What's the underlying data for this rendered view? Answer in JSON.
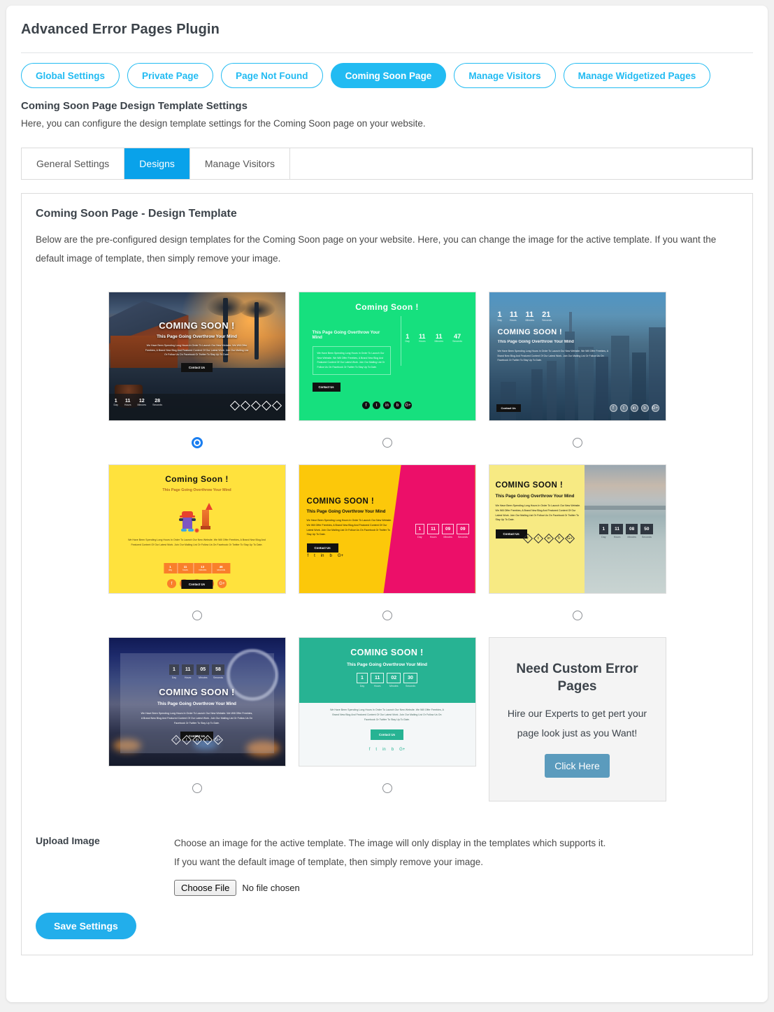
{
  "header": {
    "plugin_title": "Advanced Error Pages Plugin"
  },
  "pill_nav": {
    "items": [
      {
        "label": "Global Settings",
        "active": false
      },
      {
        "label": "Private Page",
        "active": false
      },
      {
        "label": "Page Not Found",
        "active": false
      },
      {
        "label": "Coming Soon Page",
        "active": true
      },
      {
        "label": "Manage Visitors",
        "active": false
      },
      {
        "label": "Manage Widgetized Pages",
        "active": false
      }
    ],
    "accent_color": "#22bbf2"
  },
  "section": {
    "title": "Coming Soon Page Design Template Settings",
    "description": "Here, you can configure the design template settings for the Coming Soon page on your website."
  },
  "subtabs": {
    "items": [
      {
        "label": "General Settings",
        "active": false
      },
      {
        "label": "Designs",
        "active": true
      },
      {
        "label": "Manage Visitors",
        "active": false
      }
    ],
    "active_color": "#09a2ea"
  },
  "panel": {
    "title": "Coming Soon Page - Design Template",
    "description": "Below are the pre-configured design templates for the Coming Soon page on your website. Here, you can change the image for the active template. If you want the default image of template, then simply remove your image."
  },
  "templates": [
    {
      "id": "template-1",
      "style": "tropical-resort",
      "selected": true,
      "heading": "COMING SOON !",
      "subheading": "This Page Going Overthrow Your Mind",
      "body": "We Have Been Spending Long Hours In Order To Launch Our New Website. We Will Offer Freebies, A Brand New Blog And Featured Content Of Our Latest Work. Join Our Mailing List Or Follow Us On Facebook Or Twitter To Stay Up To Date.",
      "button": "Contact Us",
      "countdown": {
        "day": "1",
        "hours": "11",
        "minutes": "12",
        "seconds": "28"
      },
      "countdown_labels": [
        "Day",
        "Hours",
        "Minutes",
        "Seconds"
      ],
      "social": [
        "f",
        "t",
        "in",
        "b",
        "G+"
      ]
    },
    {
      "id": "template-2",
      "style": "green-flat",
      "selected": false,
      "heading": "Coming Soon !",
      "subheading": "This Page Going Overthrow Your Mind",
      "body": "We Have Been Spending Long Hours In Order To Launch Our New Website. We Will Offer Freebies, A Brand New Blog And Featured Content Of Our Latest Work. Join Our Mailing List Or Follow Us On Facebook Or Twitter To Stay Up To Date.",
      "button": "Contact Us",
      "countdown": {
        "day": "1",
        "hours": "11",
        "minutes": "11",
        "seconds": "47"
      },
      "countdown_labels": [
        "Day",
        "Hours",
        "Minutes",
        "Seconds"
      ],
      "social": [
        "f",
        "t",
        "in",
        "b",
        "G+"
      ],
      "bg_color": "#16e07e"
    },
    {
      "id": "template-3",
      "style": "city-skyline-blue",
      "selected": false,
      "heading": "COMING SOON !",
      "subheading": "This Page Going Overthrow Your Mind",
      "body": "We Have Been Spending Long Hours In Order To Launch Our New Website. We Will Offer Freebies, A Brand New Blog And Featured Content Of Our Latest Work. Join Our Mailing List Or Follow Us On Facebook Or Twitter To Stay Up To Date.",
      "button": "Contact Us",
      "countdown": {
        "day": "1",
        "hours": "11",
        "minutes": "11",
        "seconds": "21"
      },
      "countdown_labels": [
        "Day",
        "Hours",
        "Minutes",
        "Seconds"
      ],
      "social": [
        "f",
        "t",
        "in",
        "b",
        "G+"
      ]
    },
    {
      "id": "template-4",
      "style": "yellow-rocket",
      "selected": false,
      "heading": "Coming Soon !",
      "subheading": "This Page Going Overthrow Your Mind",
      "body": "We Have Been Spending Long Hours In Order To Launch Our New Website. We Will Offer Freebies, A Brand New Blog And Featured Content Of Our Latest Work. Join Our Mailing List Or Follow Us On Facebook Or Twitter To Stay Up To Date.",
      "button": "Contact Us",
      "countdown": {
        "day": "1",
        "hours": "11",
        "minutes": "13",
        "seconds": "46"
      },
      "countdown_labels": [
        "day",
        "hours",
        "minutes",
        "seconds"
      ],
      "social": [
        "f",
        "t",
        "in",
        "b",
        "G+"
      ],
      "bg_color": "#ffe23d"
    },
    {
      "id": "template-5",
      "style": "yellow-pink-split",
      "selected": false,
      "heading": "COMING SOON !",
      "subheading": "This Page Going Overthrow Your Mind",
      "body": "We Have Been Spending Long Hours In Order To Launch Our New Website. We Will Offer Freebies, A Brand New Blog And Featured Content Of Our Latest Work. Join Our Mailing List Or Follow Us On Facebook Or Twitter To Stay Up To Date.",
      "button": "Contact Us",
      "countdown": {
        "day": "1",
        "hours": "11",
        "minutes": "09",
        "seconds": "09"
      },
      "countdown_labels": [
        "Day",
        "Hours",
        "Minutes",
        "Seconds"
      ],
      "social": [
        "f",
        "t",
        "in",
        "b",
        "G+"
      ],
      "bg_color": "#fcc80a",
      "accent_color": "#ec0f69"
    },
    {
      "id": "template-6",
      "style": "yellow-seascape",
      "selected": false,
      "heading": "COMING SOON !",
      "subheading": "This Page Going Overthrow Your Mind",
      "body": "We Have Been Spending Long Hours In Order To Launch Our New Website. We Will Offer Freebies, A Brand New Blog And Featured Content Of Our Latest Work. Join Our Mailing List Or Follow Us On Facebook Or Twitter To Stay Up To Date.",
      "button": "Contact Us",
      "countdown": {
        "day": "1",
        "hours": "11",
        "minutes": "08",
        "seconds": "50"
      },
      "countdown_labels": [
        "Day",
        "Hours",
        "Minutes",
        "Seconds"
      ],
      "social": [
        "f",
        "t",
        "in",
        "b",
        "G+"
      ],
      "bg_color": "#f7ea83"
    },
    {
      "id": "template-7",
      "style": "night-ferris-wheel",
      "selected": false,
      "heading": "COMING SOON !",
      "subheading": "This Page Going Overthrow Your Mind",
      "body": "We Have Been Spending Long Hours In Order To Launch Our New Website. We Will Offer Freebies, A Brand New Blog And Featured Content Of Our Latest Work. Join Our Mailing List Or Follow Us On Facebook Or Twitter To Stay Up To Date.",
      "button": "Contact Us",
      "countdown": {
        "day": "1",
        "hours": "11",
        "minutes": "05",
        "seconds": "58"
      },
      "countdown_labels": [
        "Day",
        "Hours",
        "Minutes",
        "Seconds"
      ],
      "social": [
        "f",
        "t",
        "in",
        "b",
        "G+"
      ]
    },
    {
      "id": "template-8",
      "style": "teal-header",
      "selected": false,
      "heading": "COMING SOON !",
      "subheading": "This Page Going Overthrow Your Mind",
      "body": "We Have Been Spending Long Hours In Order To Launch Our New Website. We Will Offer Freebies, A Brand New Blog And Featured Content Of Our Latest Work. Join Our Mailing List Or Follow Us On Facebook Or Twitter To Stay Up To Date.",
      "button": "Contact Us",
      "countdown": {
        "day": "1",
        "hours": "11",
        "minutes": "02",
        "seconds": "30"
      },
      "countdown_labels": [
        "Day",
        "Hours",
        "Minutes",
        "Seconds"
      ],
      "social": [
        "f",
        "t",
        "in",
        "b",
        "G+"
      ],
      "bg_color": "#27b393"
    }
  ],
  "promo": {
    "title": "Need Custom Error Pages",
    "text": "Hire our Experts to get pert your page look just as you Want!",
    "button": "Click Here",
    "button_color": "#5b9bbd"
  },
  "upload": {
    "label": "Upload Image",
    "line1": "Choose an image for the active template. The image will only display in the templates which supports it.",
    "line2": "If you want the default image of template, then simply remove your image.",
    "file_button": "Choose File",
    "file_status": "No file chosen"
  },
  "footer": {
    "save_button": "Save Settings",
    "save_color": "#22aeeb"
  }
}
